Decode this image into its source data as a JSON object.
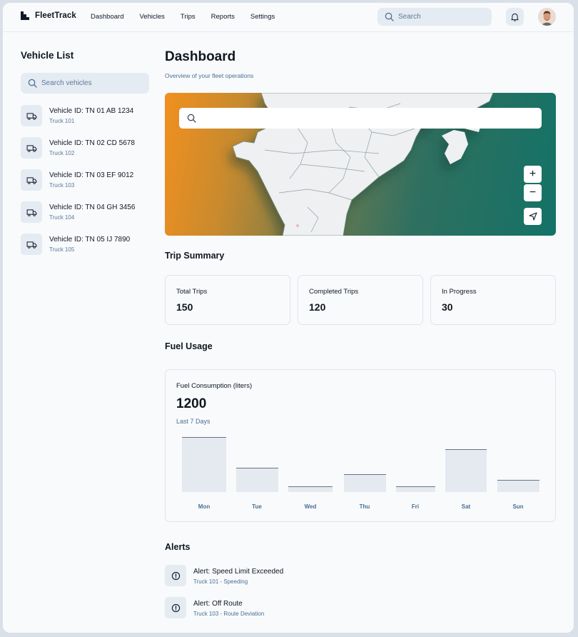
{
  "app": {
    "brand": "FleetTrack"
  },
  "nav": {
    "items": [
      "Dashboard",
      "Vehicles",
      "Trips",
      "Reports",
      "Settings"
    ],
    "search_placeholder": "Search"
  },
  "sidebar": {
    "title": "Vehicle List",
    "search_placeholder": "Search vehicles",
    "vehicles": [
      {
        "name": "Vehicle ID: TN 01 AB 1234",
        "sub": "Truck 101"
      },
      {
        "name": "Vehicle ID: TN 02 CD 5678",
        "sub": "Truck 102"
      },
      {
        "name": "Vehicle ID: TN 03 EF 9012",
        "sub": "Truck 103"
      },
      {
        "name": "Vehicle ID: TN 04 GH 3456",
        "sub": "Truck 104"
      },
      {
        "name": "Vehicle ID: TN 05 IJ 7890",
        "sub": "Truck 105"
      }
    ]
  },
  "main": {
    "title": "Dashboard",
    "subtitle": "Overview of your fleet operations",
    "map": {
      "search_placeholder": "",
      "zoom_in": "+",
      "zoom_out": "−"
    },
    "trip_summary": {
      "title": "Trip Summary",
      "cards": [
        {
          "label": "Total Trips",
          "value": "150"
        },
        {
          "label": "Completed Trips",
          "value": "120"
        },
        {
          "label": "In Progress",
          "value": "30"
        }
      ]
    },
    "fuel": {
      "title": "Fuel Usage",
      "label": "Fuel Consumption (liters)",
      "value": "1200",
      "range": "Last 7 Days",
      "chart_data": {
        "type": "bar",
        "categories": [
          "Mon",
          "Tue",
          "Wed",
          "Thu",
          "Fri",
          "Sat",
          "Sun"
        ],
        "values": [
          100,
          44,
          10,
          33,
          10,
          78,
          22
        ],
        "ylim": [
          0,
          100
        ]
      }
    },
    "alerts": {
      "title": "Alerts",
      "items": [
        {
          "name": "Alert: Speed Limit Exceeded",
          "sub": "Truck 101 - Speeding"
        },
        {
          "name": "Alert: Off Route",
          "sub": "Truck 103 - Route Deviation"
        }
      ]
    }
  },
  "colors": {
    "accent": "#4a6f96",
    "map_start": "#f0901f",
    "map_end": "#137266"
  }
}
